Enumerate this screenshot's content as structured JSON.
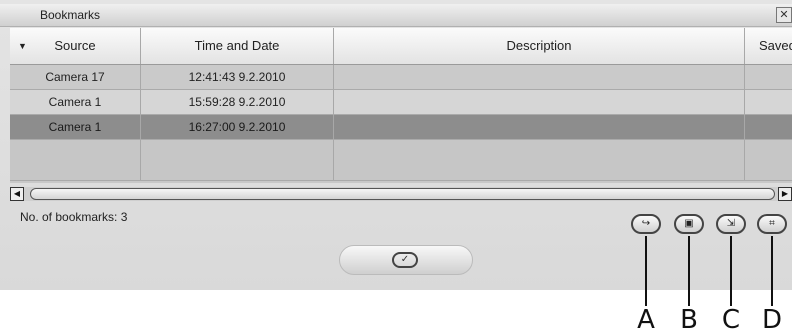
{
  "window": {
    "title": "Bookmarks",
    "close_glyph": "✕"
  },
  "table": {
    "sort_indicator": "▼",
    "columns": [
      "Source",
      "Time and Date",
      "Description",
      "Saved"
    ],
    "rows": [
      {
        "source": "Camera 17",
        "time": "12:41:43 9.2.2010",
        "description": "",
        "saved": ""
      },
      {
        "source": "Camera 1",
        "time": "15:59:28 9.2.2010",
        "description": "",
        "saved": ""
      },
      {
        "source": "Camera 1",
        "time": "16:27:00 9.2.2010",
        "description": "",
        "saved": ""
      }
    ],
    "selected_row": 2
  },
  "status": {
    "count_label": "No. of bookmarks: 3"
  },
  "buttons": {
    "ok_glyph": "✓",
    "toolbar": [
      {
        "name": "goto-bookmark-button",
        "glyph": "↪",
        "callout": "A"
      },
      {
        "name": "save-bookmark-button",
        "glyph": "▣",
        "callout": "B"
      },
      {
        "name": "export-bookmark-button",
        "glyph": "⇲",
        "callout": "C"
      },
      {
        "name": "bookmark-settings-button",
        "glyph": "⌗",
        "callout": "D"
      }
    ]
  },
  "callouts": [
    "A",
    "B",
    "C",
    "D"
  ]
}
